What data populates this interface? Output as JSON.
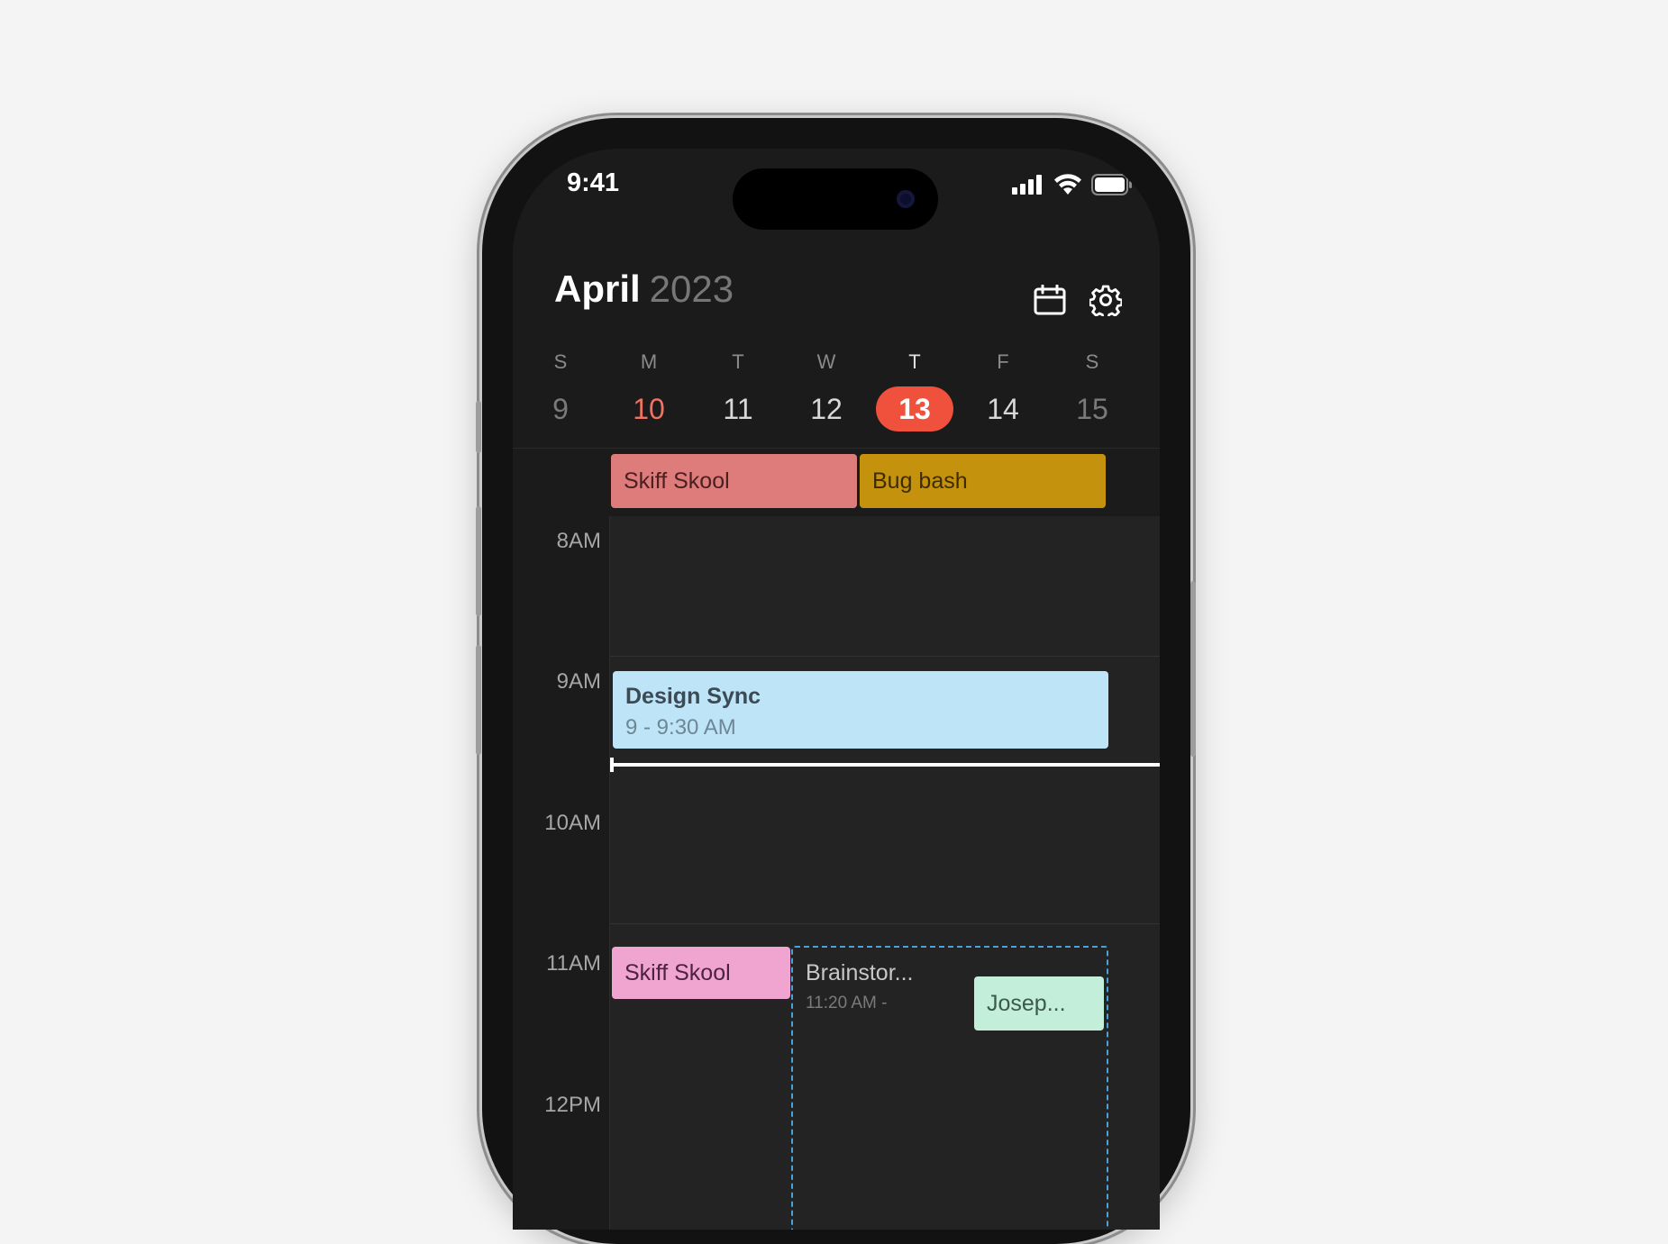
{
  "status": {
    "time": "9:41"
  },
  "header": {
    "month": "April",
    "year": "2023"
  },
  "week": [
    {
      "letter": "S",
      "date": "9"
    },
    {
      "letter": "M",
      "date": "10"
    },
    {
      "letter": "T",
      "date": "11"
    },
    {
      "letter": "W",
      "date": "12"
    },
    {
      "letter": "T",
      "date": "13"
    },
    {
      "letter": "F",
      "date": "14"
    },
    {
      "letter": "S",
      "date": "15"
    }
  ],
  "all_day_events": [
    {
      "title": "Skiff Skool",
      "color": "#de7b7b"
    },
    {
      "title": "Bug bash",
      "color": "#c4920d"
    }
  ],
  "hours": [
    "8AM",
    "9AM",
    "10AM",
    "11AM",
    "12PM"
  ],
  "events": {
    "design_sync": {
      "title": "Design Sync",
      "time": "9 - 9:30 AM",
      "color": "#bde4f7"
    },
    "skiff_skool": {
      "title": "Skiff Skool",
      "color": "#f0a4d0"
    },
    "brainstorm": {
      "title": "Brainstor...",
      "time": "11:20 AM -",
      "border_color": "#4aa3d8"
    },
    "joseph": {
      "title": "Josep...",
      "color": "#c3eed9"
    }
  },
  "colors": {
    "today_bg": "#f0513c",
    "selected_text": "#f07261"
  },
  "icons": [
    "calendar-icon",
    "gear-icon",
    "signal-icon",
    "wifi-icon",
    "battery-icon"
  ]
}
